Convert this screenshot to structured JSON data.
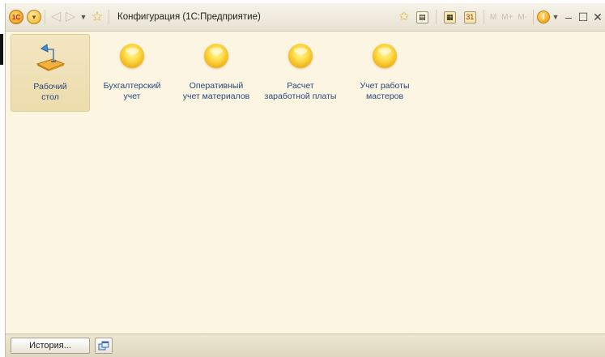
{
  "window": {
    "title": "Конфигурация  (1С:Предприятие)"
  },
  "titlebar": {
    "logo_text": "1С",
    "m_buttons": [
      "M",
      "M+",
      "M-"
    ],
    "info_glyph": "i",
    "minimize_glyph": "–",
    "restore_glyph": "☐",
    "close_glyph": "✕"
  },
  "sections": [
    {
      "label": "Рабочий\nстол",
      "icon": "desktop-lamp-icon",
      "active": true
    },
    {
      "label": "Бухгалтерский\nучет",
      "icon": "yellow-ball-icon",
      "active": false
    },
    {
      "label": "Оперативный\nучет материалов",
      "icon": "yellow-ball-icon",
      "active": false
    },
    {
      "label": "Расчет\nзаработной платы",
      "icon": "yellow-ball-icon",
      "active": false
    },
    {
      "label": "Учет работы\nмастеров",
      "icon": "yellow-ball-icon",
      "active": false
    }
  ],
  "bottombar": {
    "history_label": "История..."
  },
  "colors": {
    "background": "#fbf5e1",
    "active_section": "#efe0b4",
    "section_text": "#29467a"
  }
}
